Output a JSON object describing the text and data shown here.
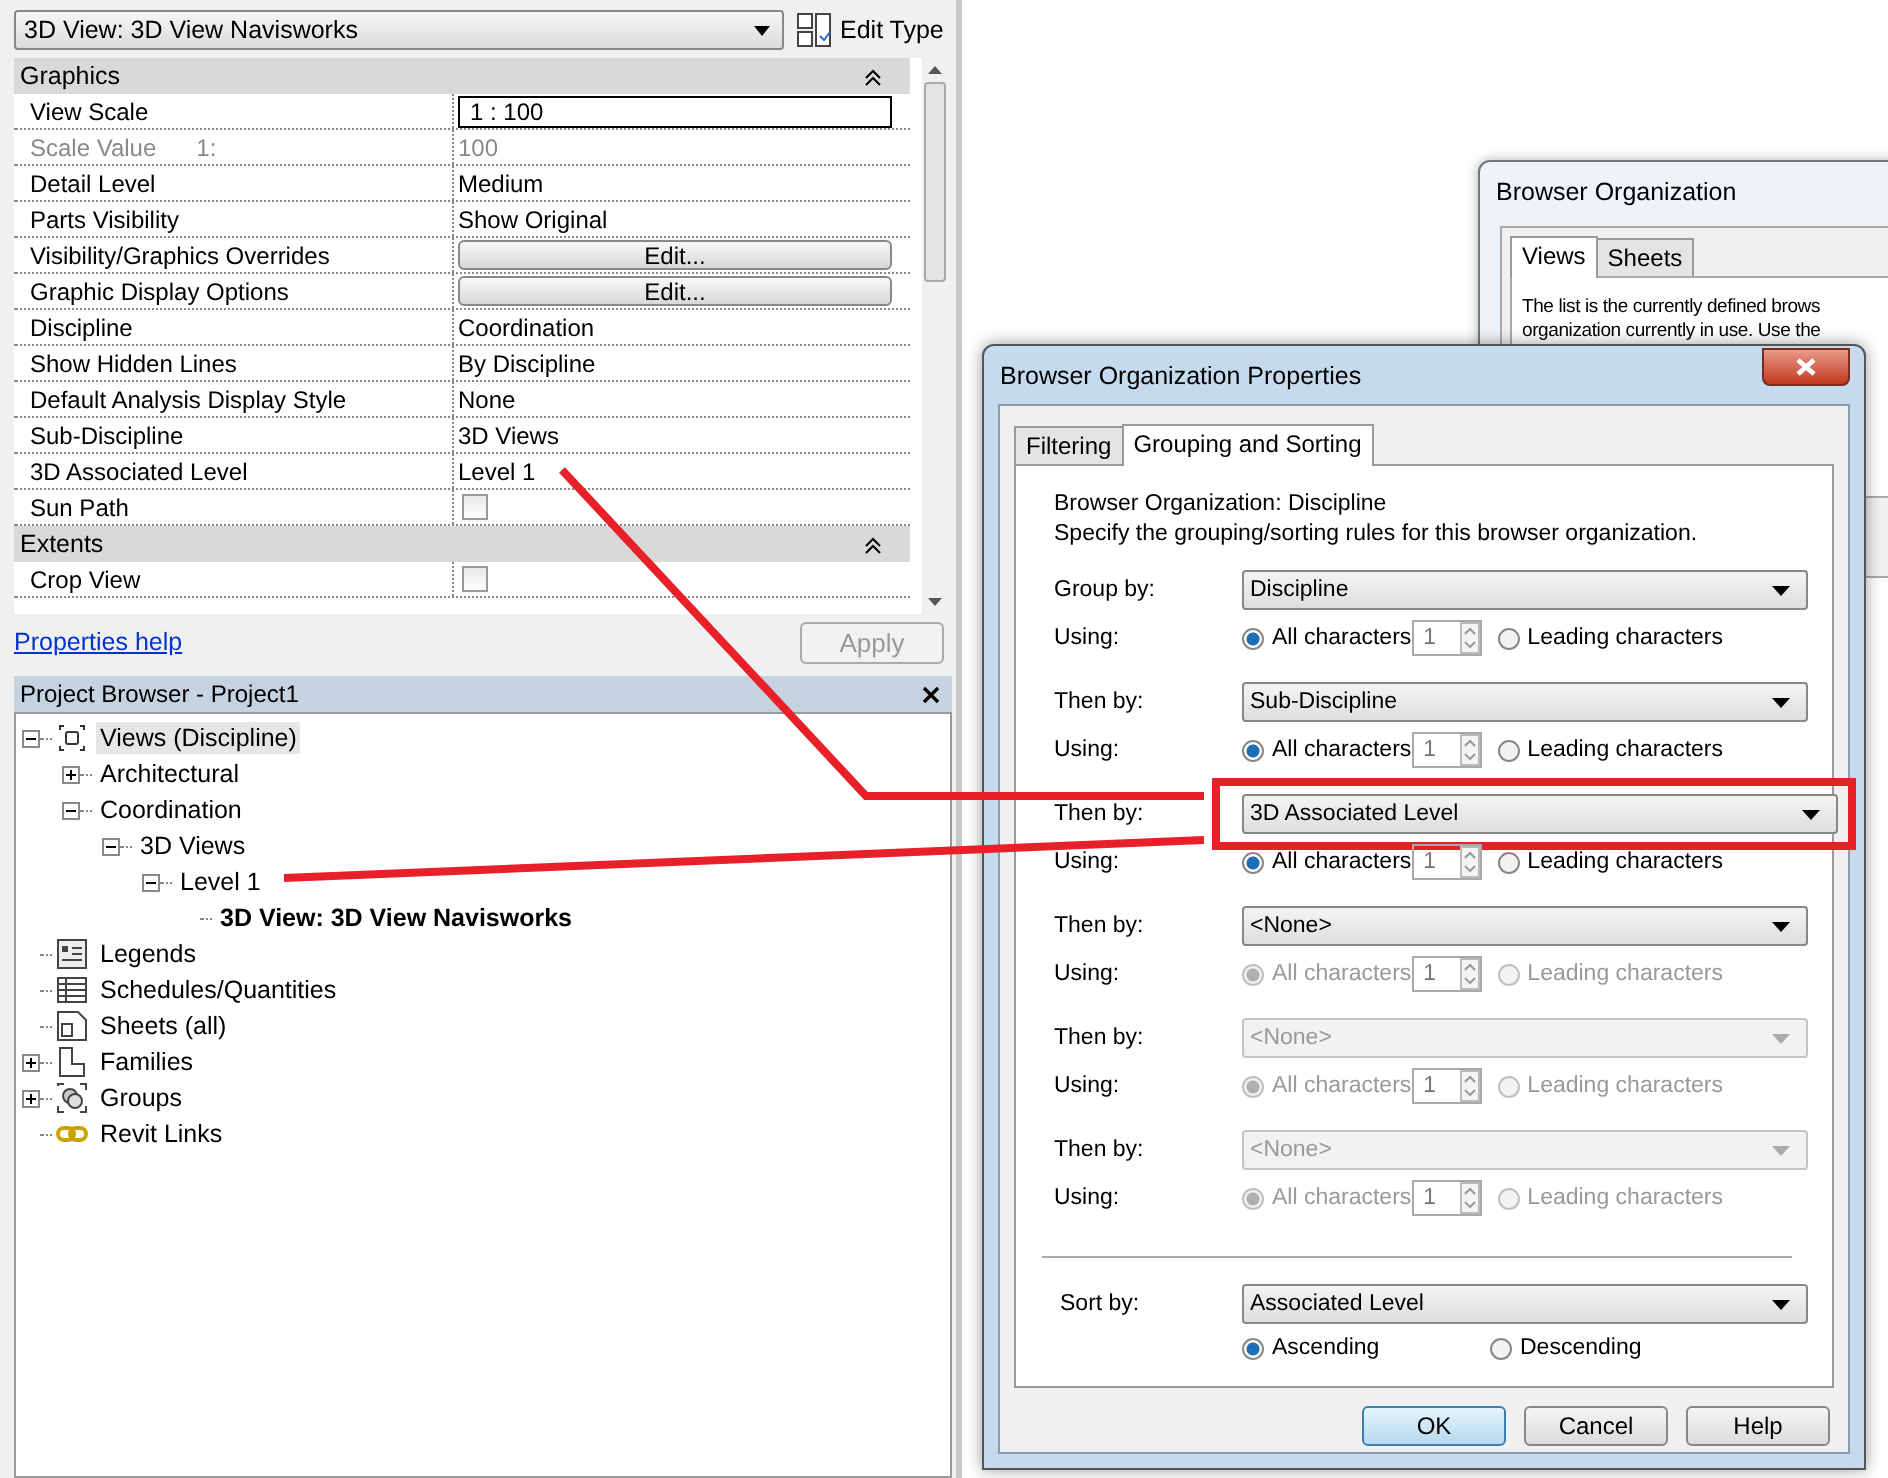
{
  "properties": {
    "type_selector": "3D View: 3D View Navisworks",
    "edit_type": "Edit Type",
    "groups": [
      {
        "title": "Graphics",
        "expanded": true,
        "rows": [
          {
            "label": "View Scale",
            "kind": "field",
            "value": "1 : 100",
            "disabled": false
          },
          {
            "label": "Scale Value",
            "suffix": "1:",
            "kind": "text",
            "value": "100",
            "disabled": true
          },
          {
            "label": "Detail Level",
            "kind": "text",
            "value": "Medium",
            "disabled": false
          },
          {
            "label": "Parts Visibility",
            "kind": "text",
            "value": "Show Original",
            "disabled": false
          },
          {
            "label": "Visibility/Graphics Overrides",
            "kind": "button",
            "value": "Edit...",
            "disabled": false
          },
          {
            "label": "Graphic Display Options",
            "kind": "button",
            "value": "Edit...",
            "disabled": false
          },
          {
            "label": "Discipline",
            "kind": "text",
            "value": "Coordination",
            "disabled": false
          },
          {
            "label": "Show Hidden Lines",
            "kind": "text",
            "value": "By Discipline",
            "disabled": false
          },
          {
            "label": "Default Analysis Display Style",
            "kind": "text",
            "value": "None",
            "disabled": false
          },
          {
            "label": "Sub-Discipline",
            "kind": "text",
            "value": "3D Views",
            "disabled": false
          },
          {
            "label": "3D Associated Level",
            "kind": "text",
            "value": "Level 1",
            "disabled": false
          },
          {
            "label": "Sun Path",
            "kind": "checkbox",
            "checked": false,
            "disabled": false
          }
        ]
      },
      {
        "title": "Extents",
        "expanded": true,
        "rows": [
          {
            "label": "Crop View",
            "kind": "checkbox",
            "checked": false,
            "disabled": false
          }
        ]
      }
    ],
    "help_link": "Properties help",
    "apply": {
      "label": "Apply",
      "disabled": true
    }
  },
  "project_browser": {
    "title": "Project Browser - Project1",
    "tree": [
      {
        "label": "Views (Discipline)",
        "kind": "views",
        "expanded": true,
        "selected": true,
        "current": false,
        "children": [
          {
            "label": "Architectural",
            "expanded": false,
            "selected": false,
            "current": false
          },
          {
            "label": "Coordination",
            "expanded": true,
            "selected": false,
            "current": false,
            "children": [
              {
                "label": "3D Views",
                "expanded": true,
                "selected": false,
                "current": false,
                "children": [
                  {
                    "label": "Level 1",
                    "expanded": true,
                    "selected": false,
                    "current": false,
                    "children": [
                      {
                        "label": "3D View: 3D View Navisworks",
                        "selected": false,
                        "current": true
                      }
                    ]
                  }
                ]
              }
            ]
          }
        ]
      },
      {
        "label": "Legends",
        "kind": "legends",
        "selected": false,
        "current": false
      },
      {
        "label": "Schedules/Quantities",
        "kind": "schedules",
        "selected": false,
        "current": false
      },
      {
        "label": "Sheets (all)",
        "kind": "sheets",
        "selected": false,
        "current": false
      },
      {
        "label": "Families",
        "kind": "families",
        "expanded": false,
        "selected": false,
        "current": false
      },
      {
        "label": "Groups",
        "kind": "groups",
        "expanded": false,
        "selected": false,
        "current": false
      },
      {
        "label": "Revit Links",
        "kind": "links",
        "selected": false,
        "current": false
      }
    ]
  },
  "background_dialog": {
    "title": "Browser Organization",
    "tabs": [
      {
        "label": "Views",
        "selected": true
      },
      {
        "label": "Sheets",
        "selected": false
      }
    ],
    "text_lines": [
      "The list is the currently defined brows",
      "organization currently in use. Use the"
    ]
  },
  "dialog": {
    "title": "Browser Organization Properties",
    "tabs": [
      {
        "label": "Filtering",
        "selected": false
      },
      {
        "label": "Grouping and Sorting",
        "selected": true
      }
    ],
    "header_lines": [
      "Browser Organization: Discipline",
      "Specify the grouping/sorting rules for this browser organization."
    ],
    "groupings": [
      {
        "label": "Group by:",
        "value": "Discipline",
        "disabled": false,
        "highlighted": false,
        "using_label": "Using:",
        "options": [
          {
            "label": "All characters",
            "selected": true
          },
          {
            "label": "Leading characters",
            "selected": false
          }
        ],
        "count": "1"
      },
      {
        "label": "Then by:",
        "value": "Sub-Discipline",
        "disabled": false,
        "highlighted": false,
        "using_label": "Using:",
        "options": [
          {
            "label": "All characters",
            "selected": true
          },
          {
            "label": "Leading characters",
            "selected": false
          }
        ],
        "count": "1"
      },
      {
        "label": "Then by:",
        "value": "3D Associated Level",
        "disabled": false,
        "highlighted": true,
        "using_label": "Using:",
        "options": [
          {
            "label": "All characters",
            "selected": true
          },
          {
            "label": "Leading characters",
            "selected": false
          }
        ],
        "count": "1"
      },
      {
        "label": "Then by:",
        "value": "<None>",
        "disabled": false,
        "highlighted": false,
        "using_label": "Using:",
        "options": [
          {
            "label": "All characters",
            "selected": true
          },
          {
            "label": "Leading characters",
            "selected": false
          }
        ],
        "count": "1",
        "options_disabled": true
      },
      {
        "label": "Then by:",
        "value": "<None>",
        "disabled": true,
        "highlighted": false,
        "using_label": "Using:",
        "options": [
          {
            "label": "All characters",
            "selected": true
          },
          {
            "label": "Leading characters",
            "selected": false
          }
        ],
        "count": "1",
        "options_disabled": true
      },
      {
        "label": "Then by:",
        "value": "<None>",
        "disabled": true,
        "highlighted": false,
        "using_label": "Using:",
        "options": [
          {
            "label": "All characters",
            "selected": true
          },
          {
            "label": "Leading characters",
            "selected": false
          }
        ],
        "count": "1",
        "options_disabled": true
      }
    ],
    "sort": {
      "label": "Sort by:",
      "value": "Associated Level",
      "options": [
        {
          "label": "Ascending",
          "selected": true
        },
        {
          "label": "Descending",
          "selected": false
        }
      ]
    },
    "buttons": [
      {
        "label": "OK",
        "default": true
      },
      {
        "label": "Cancel",
        "default": false
      },
      {
        "label": "Help",
        "default": false
      }
    ]
  }
}
